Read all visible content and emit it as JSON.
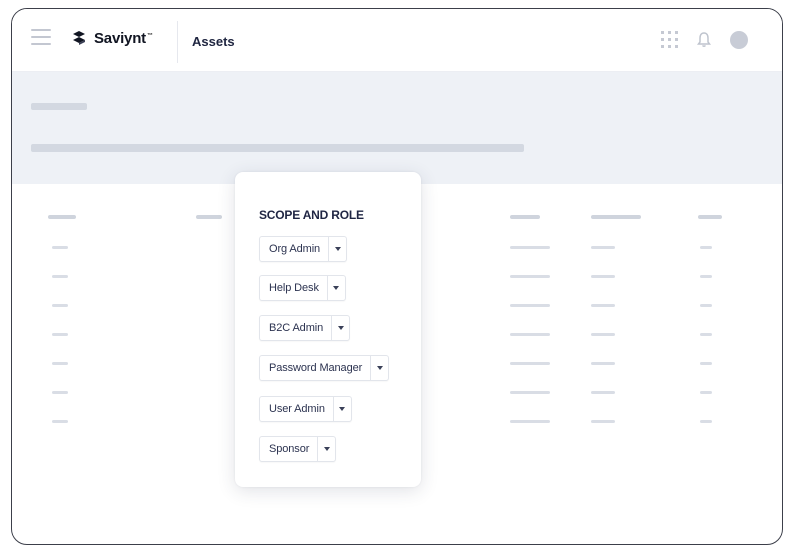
{
  "header": {
    "brand": "Saviynt",
    "brand_tm": "™",
    "page_title": "Assets",
    "icons": [
      "menu-icon",
      "apps-grid-icon",
      "bell-icon",
      "avatar"
    ]
  },
  "scope_popover": {
    "title": "SCOPE AND ROLE",
    "roles": [
      {
        "label": "Org Admin"
      },
      {
        "label": "Help Desk"
      },
      {
        "label": "B2C Admin"
      },
      {
        "label": "Password Manager"
      },
      {
        "label": "User Admin"
      },
      {
        "label": "Sponsor"
      }
    ]
  },
  "colors": {
    "banner_bg": "#eef1f6",
    "placeholder": "#d3d8e1",
    "heading": "#1f2543",
    "frame_border": "#3c3f4a"
  }
}
